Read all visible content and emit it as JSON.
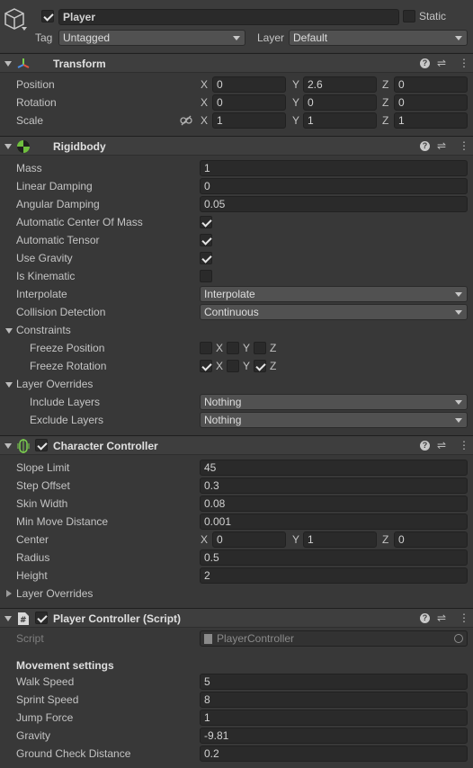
{
  "header": {
    "object_name": "Player",
    "active": true,
    "static_label": "Static",
    "static": false,
    "tag_label": "Tag",
    "tag_value": "Untagged",
    "layer_label": "Layer",
    "layer_value": "Default"
  },
  "transform": {
    "title": "Transform",
    "position_label": "Position",
    "rotation_label": "Rotation",
    "scale_label": "Scale",
    "axis_x": "X",
    "axis_y": "Y",
    "axis_z": "Z",
    "position": {
      "x": "0",
      "y": "2.6",
      "z": "0"
    },
    "rotation": {
      "x": "0",
      "y": "0",
      "z": "0"
    },
    "scale": {
      "x": "1",
      "y": "1",
      "z": "1"
    }
  },
  "rigidbody": {
    "title": "Rigidbody",
    "mass_label": "Mass",
    "mass": "1",
    "linear_damping_label": "Linear Damping",
    "linear_damping": "0",
    "angular_damping_label": "Angular Damping",
    "angular_damping": "0.05",
    "auto_center_label": "Automatic Center Of Mass",
    "auto_center": true,
    "auto_tensor_label": "Automatic Tensor",
    "auto_tensor": true,
    "use_gravity_label": "Use Gravity",
    "use_gravity": true,
    "is_kinematic_label": "Is Kinematic",
    "is_kinematic": false,
    "interpolate_label": "Interpolate",
    "interpolate": "Interpolate",
    "collision_label": "Collision Detection",
    "collision": "Continuous",
    "constraints_label": "Constraints",
    "freeze_position_label": "Freeze Position",
    "freeze_position": {
      "x": false,
      "y": false,
      "z": false
    },
    "freeze_rotation_label": "Freeze Rotation",
    "freeze_rotation": {
      "x": true,
      "y": false,
      "z": true
    },
    "layer_overrides_label": "Layer Overrides",
    "include_layers_label": "Include Layers",
    "include_layers": "Nothing",
    "exclude_layers_label": "Exclude Layers",
    "exclude_layers": "Nothing"
  },
  "character_controller": {
    "title": "Character Controller",
    "enabled": true,
    "slope_limit_label": "Slope Limit",
    "slope_limit": "45",
    "step_offset_label": "Step Offset",
    "step_offset": "0.3",
    "skin_width_label": "Skin Width",
    "skin_width": "0.08",
    "min_move_label": "Min Move Distance",
    "min_move": "0.001",
    "center_label": "Center",
    "center": {
      "x": "0",
      "y": "1",
      "z": "0"
    },
    "radius_label": "Radius",
    "radius": "0.5",
    "height_label": "Height",
    "height": "2",
    "layer_overrides_label": "Layer Overrides"
  },
  "player_controller": {
    "title": "Player Controller (Script)",
    "enabled": true,
    "script_label": "Script",
    "script_value": "PlayerController",
    "section_title": "Movement settings",
    "walk_speed_label": "Walk Speed",
    "walk_speed": "5",
    "sprint_speed_label": "Sprint Speed",
    "sprint_speed": "8",
    "jump_force_label": "Jump Force",
    "jump_force": "1",
    "gravity_label": "Gravity",
    "gravity": "-9.81",
    "ground_check_label": "Ground Check Distance",
    "ground_check": "0.2"
  }
}
